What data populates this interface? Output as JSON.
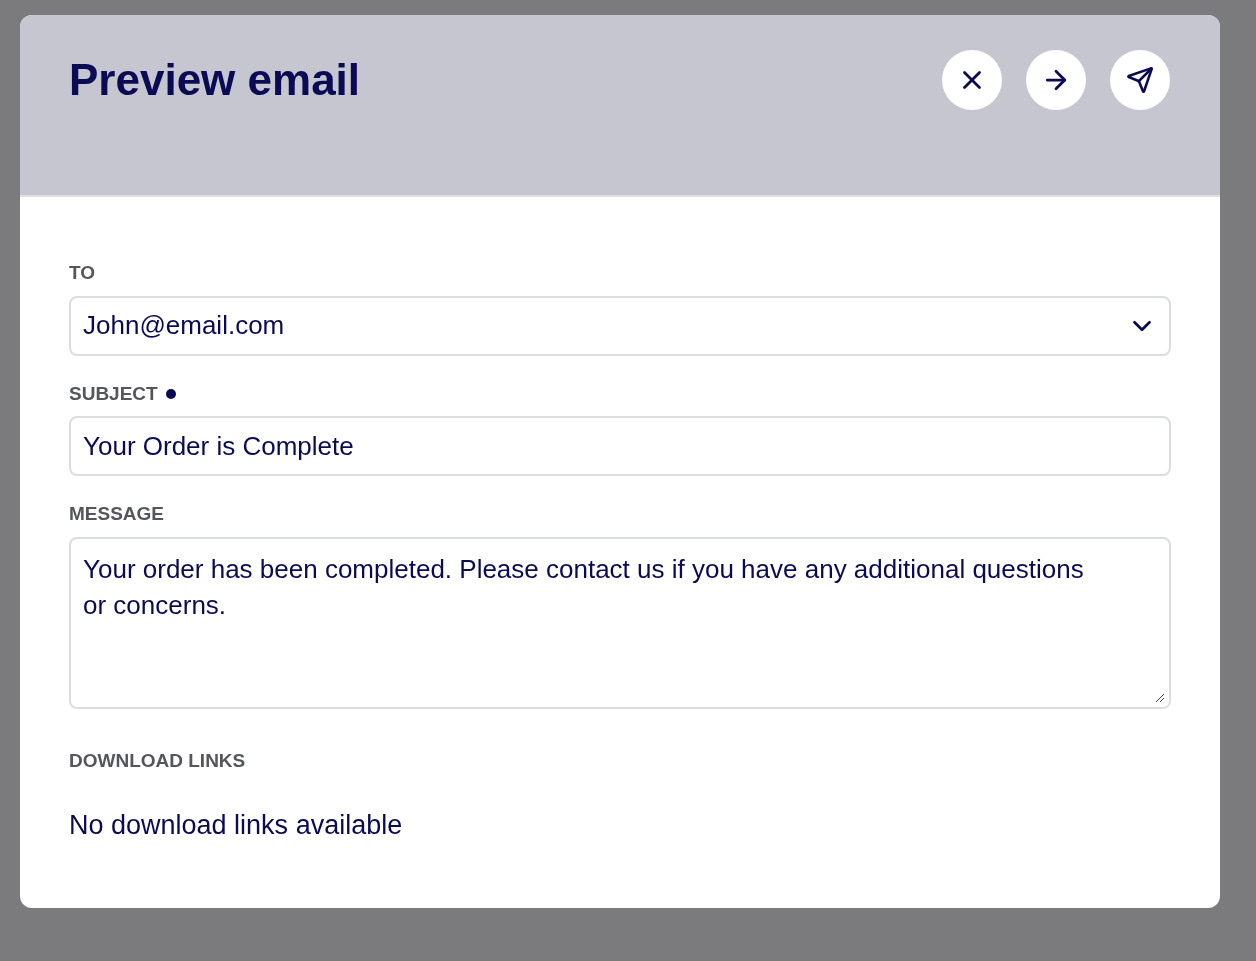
{
  "dialog": {
    "title": "Preview email"
  },
  "fields": [
    {
      "kind": "select",
      "label": "TO",
      "value": "John@email.com",
      "required": false
    },
    {
      "kind": "text",
      "label": "SUBJECT",
      "value": "Your Order is Complete",
      "required": true
    },
    {
      "kind": "textarea",
      "label": "MESSAGE",
      "value": "Your order has been completed. Please contact us if you have any additional questions or concerns.",
      "required": false
    }
  ],
  "download_links": {
    "label": "DOWNLOAD LINKS",
    "empty_text": "No download links available"
  }
}
